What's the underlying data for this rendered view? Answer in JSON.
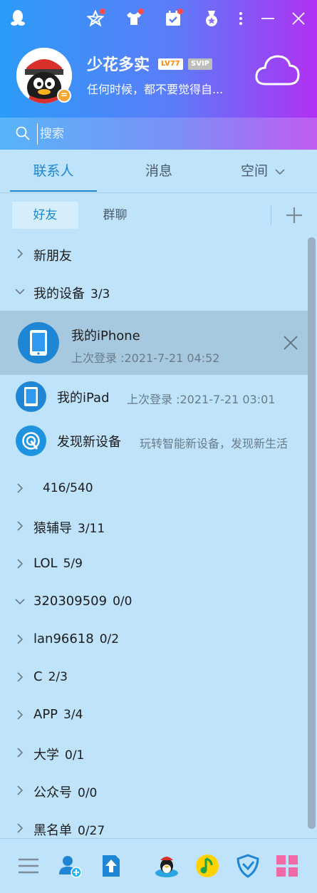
{
  "header": {
    "nickname": "少花多实",
    "level_badge": "LV77",
    "vip_badge": "SVIP",
    "signature": "任何时候，都不要觉得自...",
    "icons": [
      "qq-logo-icon",
      "zone-star-icon",
      "tshirt-icon",
      "calendar-check-icon",
      "medal-icon",
      "more-icon",
      "minimize-icon",
      "close-icon",
      "weather-cloud-icon"
    ]
  },
  "search": {
    "placeholder": "搜索"
  },
  "tabs": [
    {
      "label": "联系人",
      "active": true
    },
    {
      "label": "消息",
      "active": false
    },
    {
      "label": "空间",
      "active": false
    }
  ],
  "subtabs": [
    {
      "label": "好友",
      "active": true
    },
    {
      "label": "群聊",
      "active": false
    }
  ],
  "list": {
    "new_friends": {
      "label": "新朋友"
    },
    "my_devices": {
      "label": "我的设备",
      "count": "3/3"
    },
    "devices": [
      {
        "name": "我的iPhone",
        "sub": "上次登录 :2021-7-21 04:52",
        "icon": "iphone-icon",
        "selected": true
      },
      {
        "name": "我的iPad",
        "sub": "上次登录 :2021-7-21 03:01",
        "icon": "ipad-icon",
        "selected": false
      },
      {
        "name": "发现新设备",
        "sub": "玩转智能新设备，发现新生活",
        "icon": "discover-device-icon",
        "selected": false
      }
    ],
    "groups": [
      {
        "label": "",
        "count": "416/540",
        "expanded": false
      },
      {
        "label": "猿辅导",
        "count": "3/11",
        "expanded": false
      },
      {
        "label": "LOL",
        "count": "5/9",
        "expanded": false
      },
      {
        "label": "320309509",
        "count": "0/0",
        "expanded": true
      },
      {
        "label": "lan96618",
        "count": "0/2",
        "expanded": false
      },
      {
        "label": "C",
        "count": "2/3",
        "expanded": false
      },
      {
        "label": "APP",
        "count": "3/4",
        "expanded": false
      },
      {
        "label": "大学",
        "count": "0/1",
        "expanded": false
      },
      {
        "label": "公众号",
        "count": "0/0",
        "expanded": false
      },
      {
        "label": "黑名单",
        "count": "0/27",
        "expanded": false
      }
    ]
  },
  "bottom_bar": {
    "icons": [
      "main-menu-icon",
      "add-friend-icon",
      "file-transfer-icon",
      "penguin-game-icon",
      "qq-music-icon",
      "security-shield-icon",
      "app-manager-icon"
    ]
  },
  "colors": {
    "header_start": "#2b9cf8",
    "header_end": "#b130f4",
    "panel_bg": "#bfe3fb",
    "accent": "#1a86d6",
    "selected_row": "#a7c9e0"
  }
}
